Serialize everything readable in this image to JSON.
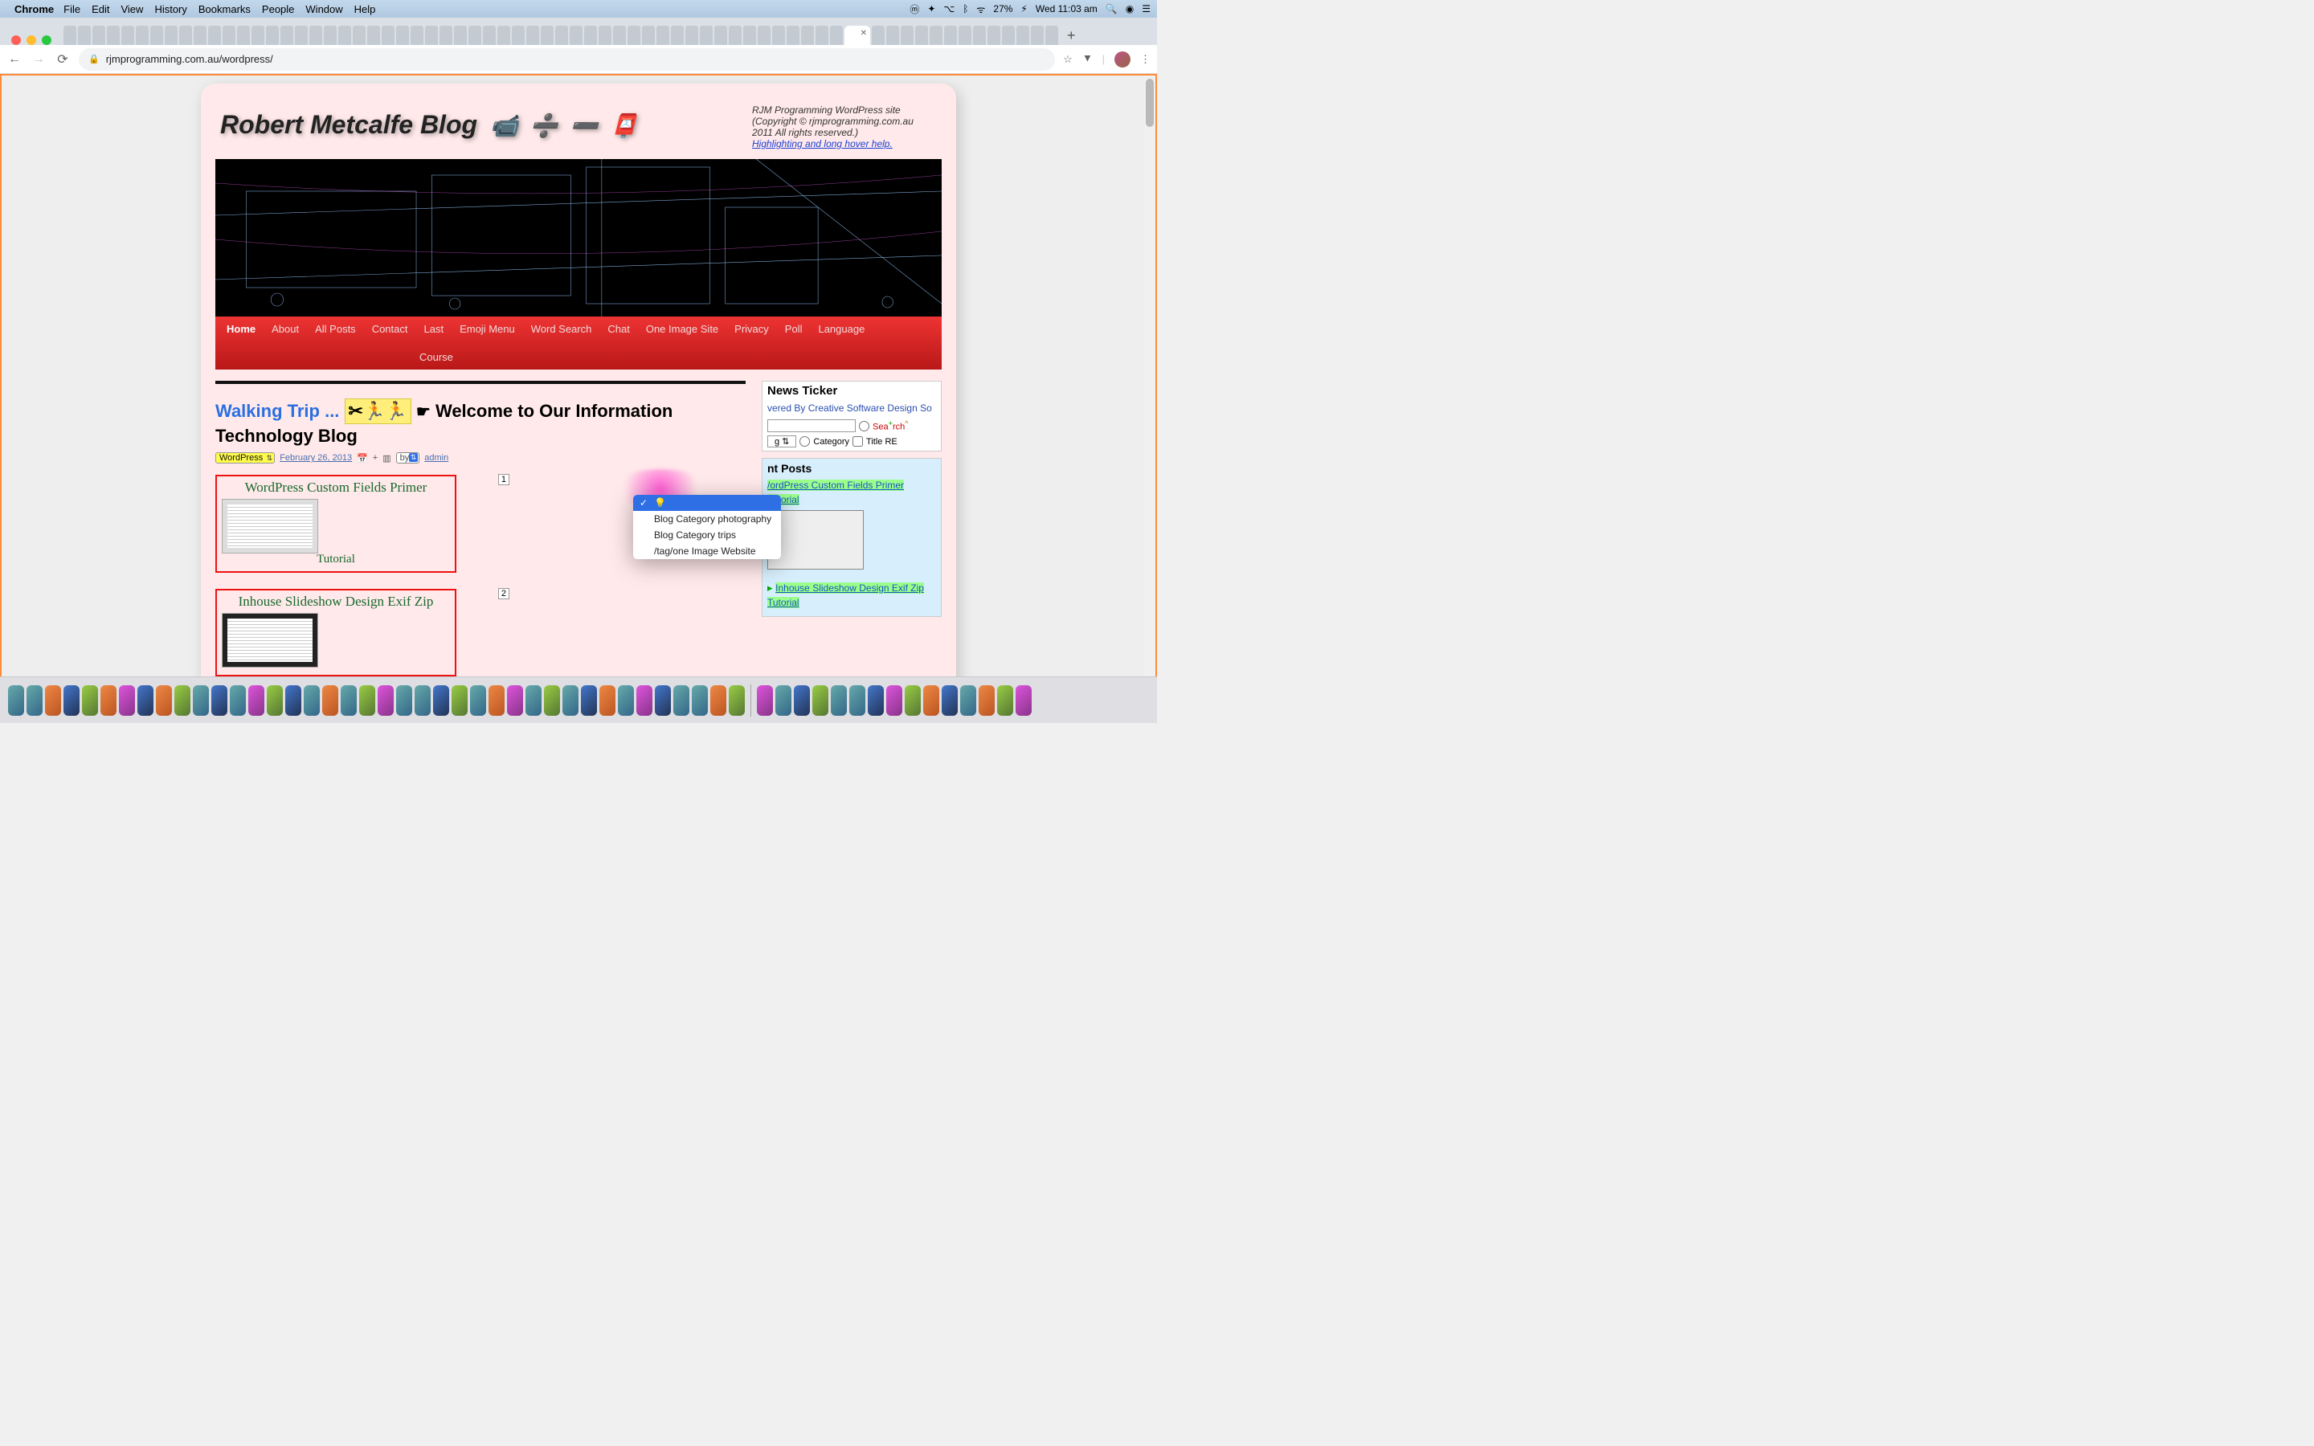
{
  "menubar": {
    "app": "Chrome",
    "items": [
      "File",
      "Edit",
      "View",
      "History",
      "Bookmarks",
      "People",
      "Window",
      "Help"
    ],
    "battery": "27%",
    "clock": "Wed 11:03 am"
  },
  "browser": {
    "url": "rjmprogramming.com.au/wordpress/"
  },
  "blog": {
    "title": "Robert Metcalfe Blog",
    "blurb_line1": "RJM Programming WordPress site",
    "blurb_line2": "(Copyright © rjmprogramming.com.au 2011 All rights reserved.)",
    "blurb_link": "Highlighting and long hover help.",
    "nav": [
      "Home",
      "About",
      "All Posts",
      "Contact",
      "Last",
      "Emoji Menu",
      "Word Search",
      "Chat",
      "One Image Site",
      "Privacy",
      "Poll",
      "Language"
    ],
    "nav_row2": "Course",
    "heading_walk": "Walking Trip ...",
    "heading_rest": "Welcome to Our Information Technology Blog",
    "meta_tag": "WordPress",
    "meta_date": "February 26, 2013",
    "meta_plus": "+",
    "meta_by": "by",
    "meta_author": "admin",
    "card1_title": "WordPress Custom Fields Primer",
    "card1_sub": "Tutorial",
    "card1_badge": "1",
    "card2_title": "Inhouse Slideshow Design Exif Zip",
    "card2_badge": "2"
  },
  "sidebar": {
    "ticker_title": "News Ticker",
    "ticker_text": "vered By Creative Software Design So",
    "search_label_full": "Sea⁺rch^",
    "search_tag": "Tag",
    "search_cat": "Category",
    "search_title": "Title RE",
    "recent_title": "nt Posts",
    "recent1": "/ordPress Custom Fields Primer Tutorial",
    "recent2": "Inhouse Slideshow Design Exif Zip Tutorial"
  },
  "dropdown": {
    "opt0": "💡",
    "opt1": "Blog Category photography",
    "opt2": "Blog Category trips",
    "opt3": "/tag/one Image Website"
  }
}
